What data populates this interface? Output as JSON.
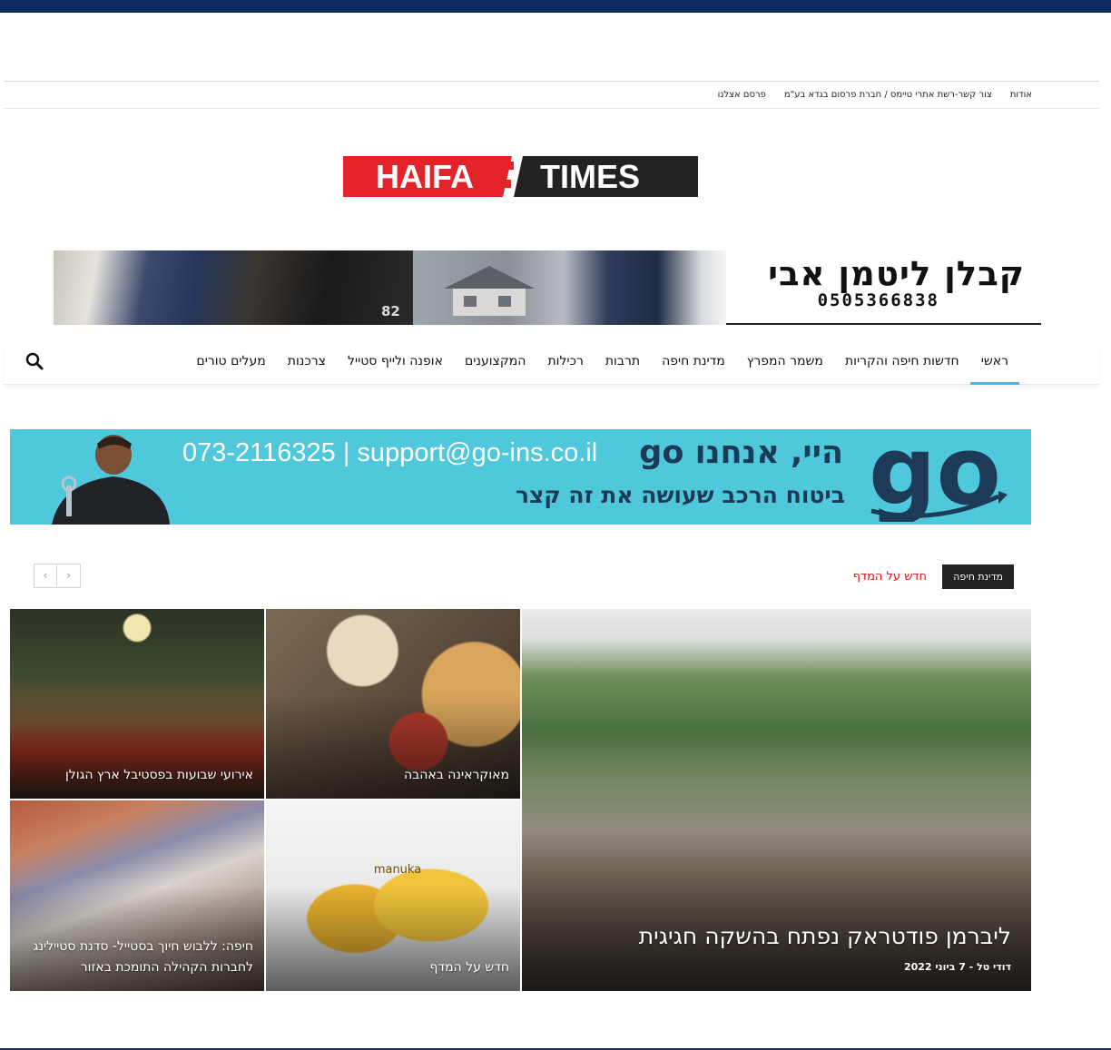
{
  "topbar": {
    "links": [
      "אודות",
      "צור קשר-רשת אתרי טיימס / חברת פרסום בגדא בע\"מ",
      "פרסם אצלנו"
    ]
  },
  "logo": {
    "left": "HAIFA",
    "right": "TIMES",
    "colors": {
      "red": "#e42229",
      "black": "#222222"
    }
  },
  "banner1": {
    "title": "קבלן ליטמן אבי",
    "phone": "0505366838",
    "photo_tag": "82"
  },
  "nav": {
    "items": [
      "ראשי",
      "חדשות חיפה והקריות",
      "משמר המפרץ",
      "מדינת חיפה",
      "תרבות",
      "רכילות",
      "המקצוענים",
      "אופנה ולייף סטייל",
      "צרכנות",
      "מעלים טורים"
    ],
    "active": "ראשי",
    "search_icon": "search-icon",
    "accent": "#4db2ec"
  },
  "banner2": {
    "contact": "073-2116325 | support@go-ins.co.il",
    "headline": "היי, אנחנו go",
    "tagline": "ביטוח הרכב שעושה את זה קצר",
    "logo_text": "go",
    "background": "#4fc8dc"
  },
  "block": {
    "category": "מדינת חיפה",
    "subcategory": "חדש על המדף",
    "pager": {
      "prev": "‹",
      "next": "›"
    }
  },
  "articles": {
    "featured": {
      "title": "ליברמן פודטראק נפתח בהשקה חגיגית",
      "author": "דודי טל",
      "date": "7 ביוני 2022"
    },
    "food": {
      "title": "מאוקראינה באהבה"
    },
    "art": {
      "title": "אירועי שבועות בפסטיבל ארץ הגולן"
    },
    "product": {
      "title": "חדש על המדף",
      "brand": "manuka"
    },
    "painting": {
      "title": "חיפה: ללבוש חיוך בסטייל- סדנת סטיילינג לחברות הקהילה התומכת באזור"
    }
  }
}
